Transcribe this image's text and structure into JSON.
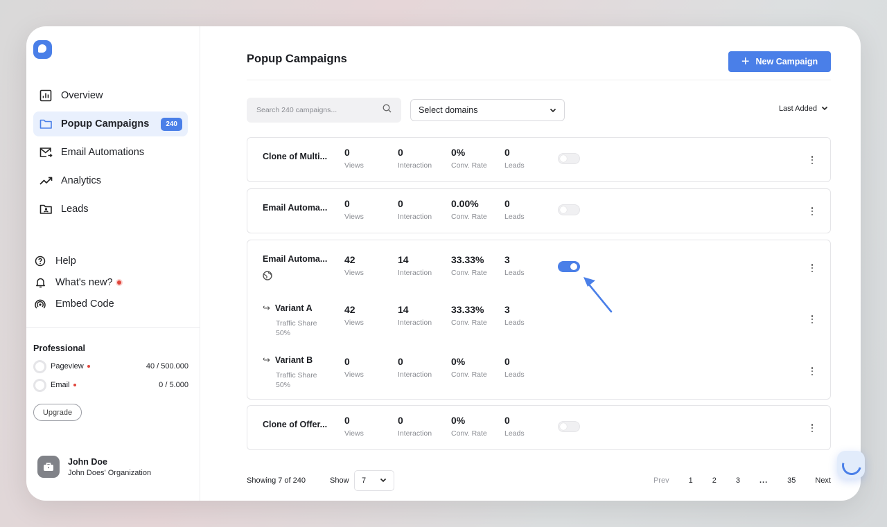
{
  "sidebar": {
    "nav": [
      {
        "label": "Overview",
        "icon": "chart-icon",
        "active": false
      },
      {
        "label": "Popup Campaigns",
        "icon": "folder-icon",
        "active": true,
        "badge": "240"
      },
      {
        "label": "Email Automations",
        "icon": "mail-icon",
        "active": false
      },
      {
        "label": "Analytics",
        "icon": "trend-icon",
        "active": false
      },
      {
        "label": "Leads",
        "icon": "user-folder-icon",
        "active": false
      }
    ],
    "help": [
      {
        "label": "Help",
        "icon": "question-icon"
      },
      {
        "label": "What's new?",
        "icon": "bell-icon",
        "dot": true
      },
      {
        "label": "Embed Code",
        "icon": "broadcast-icon"
      }
    ],
    "plan": {
      "title": "Professional",
      "usage": [
        {
          "label": "Pageview",
          "value": "40 / 500.000"
        },
        {
          "label": "Email",
          "value": "0 / 5.000"
        }
      ],
      "upgrade_label": "Upgrade"
    },
    "user": {
      "name": "John Doe",
      "org": "John Does' Organization"
    }
  },
  "header": {
    "title": "Popup Campaigns",
    "new_button": "New Campaign"
  },
  "filters": {
    "search_placeholder": "Search 240 campaigns...",
    "domains": "Select domains",
    "sort": "Last Added"
  },
  "stat_labels": {
    "views": "Views",
    "interaction": "Interaction",
    "conv": "Conv. Rate",
    "leads": "Leads"
  },
  "campaigns": [
    {
      "name": "Clone of Multi...",
      "views": "0",
      "interaction": "0",
      "conv": "0%",
      "leads": "0",
      "enabled": false
    },
    {
      "name": "Email Automa...",
      "views": "0",
      "interaction": "0",
      "conv": "0.00%",
      "leads": "0",
      "enabled": false
    },
    {
      "name": "Email Automa...",
      "views": "42",
      "interaction": "14",
      "conv": "33.33%",
      "leads": "3",
      "enabled": true,
      "variants": [
        {
          "name": "Variant A",
          "share_label": "Traffic Share",
          "share": "50%",
          "views": "42",
          "interaction": "14",
          "conv": "33.33%",
          "leads": "3"
        },
        {
          "name": "Variant B",
          "share_label": "Traffic Share",
          "share": "50%",
          "views": "0",
          "interaction": "0",
          "conv": "0%",
          "leads": "0"
        }
      ]
    },
    {
      "name": "Clone of Offer...",
      "views": "0",
      "interaction": "0",
      "conv": "0%",
      "leads": "0",
      "enabled": false
    }
  ],
  "footer": {
    "showing": "Showing 7 of 240",
    "show_label": "Show",
    "show_value": "7",
    "pager": {
      "prev": "Prev",
      "pages": [
        "1",
        "2",
        "3"
      ],
      "ellipsis": "...",
      "last": "35",
      "next": "Next"
    }
  },
  "colors": {
    "accent": "#4a7fe8",
    "active_bg": "#e9f0fd",
    "dot": "#e0463c"
  }
}
